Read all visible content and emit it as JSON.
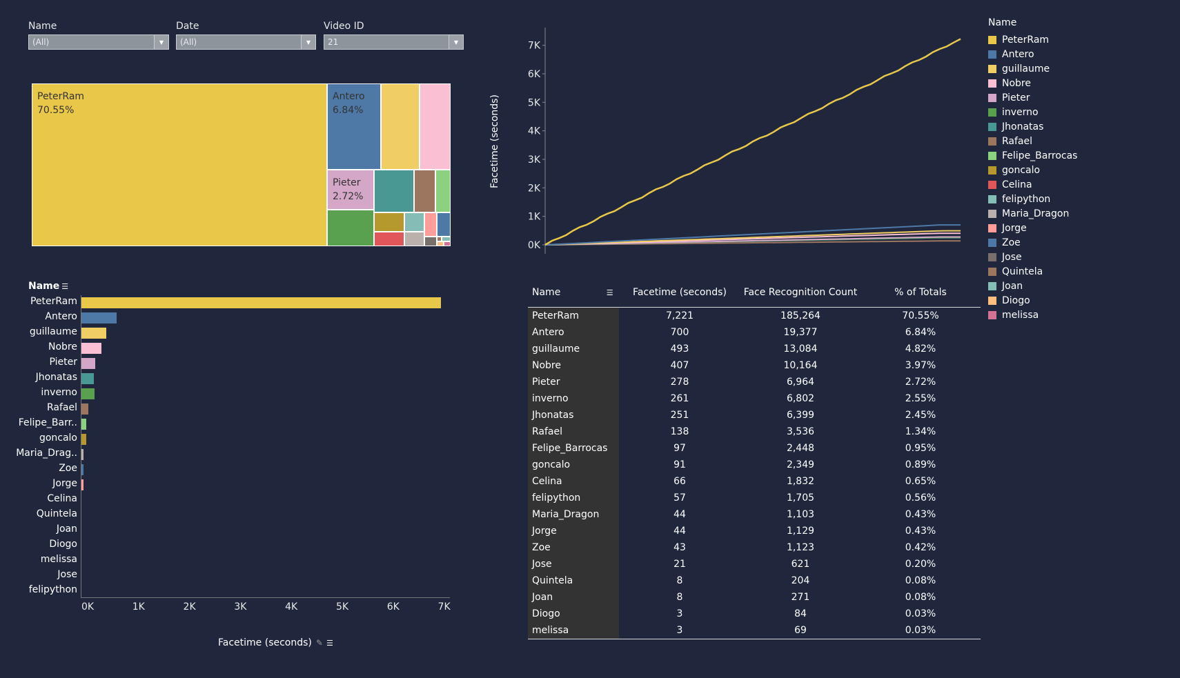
{
  "filters": [
    {
      "label": "Name",
      "value": "(All)"
    },
    {
      "label": "Date",
      "value": "(All)"
    },
    {
      "label": "Video ID",
      "value": "21"
    }
  ],
  "treemap": {
    "cells": [
      {
        "name": "PeterRam",
        "pct": "70.55%",
        "color": "#e9c748"
      },
      {
        "name": "Antero",
        "pct": "6.84%",
        "color": "#4e79a7"
      },
      {
        "name": "guillaume",
        "pct": "",
        "color": "#f1ce63"
      },
      {
        "name": "Nobre",
        "pct": "",
        "color": "#fabfd2"
      },
      {
        "name": "Pieter",
        "pct": "2.72%",
        "color": "#d4a6c8"
      },
      {
        "name": "inverno",
        "pct": "",
        "color": "#59a14f"
      },
      {
        "name": "Jhonatas",
        "pct": "",
        "color": "#499894"
      },
      {
        "name": "Rafael",
        "pct": "",
        "color": "#9d7660"
      },
      {
        "name": "Felipe_Barrocas",
        "pct": "",
        "color": "#8cd17d"
      },
      {
        "name": "goncalo",
        "pct": "",
        "color": "#b6992d"
      },
      {
        "name": "Celina",
        "pct": "",
        "color": "#e15759"
      },
      {
        "name": "felipython",
        "pct": "",
        "color": "#86bcb6"
      },
      {
        "name": "Maria_Dragon",
        "pct": "",
        "color": "#bab0ac"
      },
      {
        "name": "Jorge",
        "pct": "",
        "color": "#ff9d9a"
      },
      {
        "name": "Zoe",
        "pct": "",
        "color": "#4e79a7"
      },
      {
        "name": "Jose",
        "pct": "",
        "color": "#79706e"
      },
      {
        "name": "Quintela",
        "pct": "",
        "color": "#9d7660"
      },
      {
        "name": "Joan",
        "pct": "",
        "color": "#86bcb6"
      },
      {
        "name": "Diogo",
        "pct": "",
        "color": "#ffbe7d"
      },
      {
        "name": "melissa",
        "pct": "",
        "color": "#d37295"
      }
    ]
  },
  "bar_chart": {
    "header": "Name",
    "x_title": "Facetime (seconds)",
    "ticks": [
      "0K",
      "1K",
      "2K",
      "3K",
      "4K",
      "5K",
      "6K",
      "7K"
    ],
    "rows": [
      {
        "name": "PeterRam",
        "value": 7221,
        "color": "#e9c748"
      },
      {
        "name": "Antero",
        "value": 700,
        "color": "#4e79a7"
      },
      {
        "name": "guillaume",
        "value": 493,
        "color": "#f1ce63"
      },
      {
        "name": "Nobre",
        "value": 407,
        "color": "#fabfd2"
      },
      {
        "name": "Pieter",
        "value": 278,
        "color": "#d4a6c8"
      },
      {
        "name": "Jhonatas",
        "value": 251,
        "color": "#499894"
      },
      {
        "name": "inverno",
        "value": 261,
        "color": "#59a14f"
      },
      {
        "name": "Rafael",
        "value": 138,
        "color": "#9d7660"
      },
      {
        "name": "Felipe_Barr..",
        "value": 97,
        "color": "#8cd17d"
      },
      {
        "name": "goncalo",
        "value": 91,
        "color": "#b6992d"
      },
      {
        "name": "Maria_Drag..",
        "value": 44,
        "color": "#bab0ac"
      },
      {
        "name": "Zoe",
        "value": 43,
        "color": "#4e79a7"
      },
      {
        "name": "Jorge",
        "value": 44,
        "color": "#ff9d9a"
      },
      {
        "name": "Celina",
        "value": 0,
        "color": "#e15759"
      },
      {
        "name": "Quintela",
        "value": 0,
        "color": "#9d7660"
      },
      {
        "name": "Joan",
        "value": 0,
        "color": "#86bcb6"
      },
      {
        "name": "Diogo",
        "value": 0,
        "color": "#ffbe7d"
      },
      {
        "name": "melissa",
        "value": 0,
        "color": "#d37295"
      },
      {
        "name": "Jose",
        "value": 0,
        "color": "#79706e"
      },
      {
        "name": "felipython",
        "value": 0,
        "color": "#86bcb6"
      }
    ]
  },
  "line_chart": {
    "y_title": "Facetime (seconds)",
    "y_ticks": [
      "0K",
      "1K",
      "2K",
      "3K",
      "4K",
      "5K",
      "6K",
      "7K"
    ],
    "series": [
      {
        "name": "PeterRam",
        "final": 7221,
        "color": "#e9c748"
      },
      {
        "name": "Antero",
        "final": 700,
        "color": "#4e79a7"
      },
      {
        "name": "guillaume",
        "final": 493,
        "color": "#f1ce63"
      },
      {
        "name": "Nobre",
        "final": 407,
        "color": "#fabfd2"
      },
      {
        "name": "Pieter",
        "final": 278,
        "color": "#d4a6c8"
      },
      {
        "name": "inverno",
        "final": 261,
        "color": "#59a14f"
      },
      {
        "name": "Jhonatas",
        "final": 251,
        "color": "#499894"
      },
      {
        "name": "Rafael",
        "final": 138,
        "color": "#9d7660"
      }
    ]
  },
  "table": {
    "headers": [
      "Name",
      "Facetime (seconds)",
      "Face Recognition Count",
      "% of Totals"
    ],
    "rows": [
      [
        "PeterRam",
        "7,221",
        "185,264",
        "70.55%"
      ],
      [
        "Antero",
        "700",
        "19,377",
        "6.84%"
      ],
      [
        "guillaume",
        "493",
        "13,084",
        "4.82%"
      ],
      [
        "Nobre",
        "407",
        "10,164",
        "3.97%"
      ],
      [
        "Pieter",
        "278",
        "6,964",
        "2.72%"
      ],
      [
        "inverno",
        "261",
        "6,802",
        "2.55%"
      ],
      [
        "Jhonatas",
        "251",
        "6,399",
        "2.45%"
      ],
      [
        "Rafael",
        "138",
        "3,536",
        "1.34%"
      ],
      [
        "Felipe_Barrocas",
        "97",
        "2,448",
        "0.95%"
      ],
      [
        "goncalo",
        "91",
        "2,349",
        "0.89%"
      ],
      [
        "Celina",
        "66",
        "1,832",
        "0.65%"
      ],
      [
        "felipython",
        "57",
        "1,705",
        "0.56%"
      ],
      [
        "Maria_Dragon",
        "44",
        "1,103",
        "0.43%"
      ],
      [
        "Jorge",
        "44",
        "1,129",
        "0.43%"
      ],
      [
        "Zoe",
        "43",
        "1,123",
        "0.42%"
      ],
      [
        "Jose",
        "21",
        "621",
        "0.20%"
      ],
      [
        "Quintela",
        "8",
        "204",
        "0.08%"
      ],
      [
        "Joan",
        "8",
        "271",
        "0.08%"
      ],
      [
        "Diogo",
        "3",
        "84",
        "0.03%"
      ],
      [
        "melissa",
        "3",
        "69",
        "0.03%"
      ]
    ]
  },
  "legend": {
    "title": "Name",
    "items": [
      {
        "name": "PeterRam",
        "color": "#e9c748"
      },
      {
        "name": "Antero",
        "color": "#4e79a7"
      },
      {
        "name": "guillaume",
        "color": "#f1ce63"
      },
      {
        "name": "Nobre",
        "color": "#fabfd2"
      },
      {
        "name": "Pieter",
        "color": "#d4a6c8"
      },
      {
        "name": "inverno",
        "color": "#59a14f"
      },
      {
        "name": "Jhonatas",
        "color": "#499894"
      },
      {
        "name": "Rafael",
        "color": "#9d7660"
      },
      {
        "name": "Felipe_Barrocas",
        "color": "#8cd17d"
      },
      {
        "name": "goncalo",
        "color": "#b6992d"
      },
      {
        "name": "Celina",
        "color": "#e15759"
      },
      {
        "name": "felipython",
        "color": "#86bcb6"
      },
      {
        "name": "Maria_Dragon",
        "color": "#bab0ac"
      },
      {
        "name": "Jorge",
        "color": "#ff9d9a"
      },
      {
        "name": "Zoe",
        "color": "#4e79a7"
      },
      {
        "name": "Jose",
        "color": "#79706e"
      },
      {
        "name": "Quintela",
        "color": "#9d7660"
      },
      {
        "name": "Joan",
        "color": "#86bcb6"
      },
      {
        "name": "Diogo",
        "color": "#ffbe7d"
      },
      {
        "name": "melissa",
        "color": "#d37295"
      }
    ]
  },
  "chart_data": [
    {
      "type": "bar",
      "categories": [
        "PeterRam",
        "Antero",
        "guillaume",
        "Nobre",
        "Pieter",
        "Jhonatas",
        "inverno",
        "Rafael",
        "Felipe_Barr..",
        "goncalo",
        "Maria_Drag..",
        "Zoe",
        "Jorge",
        "Celina",
        "Quintela",
        "Joan",
        "Diogo",
        "melissa",
        "Jose",
        "felipython"
      ],
      "values": [
        7221,
        700,
        493,
        407,
        278,
        251,
        261,
        138,
        97,
        91,
        44,
        43,
        44,
        0,
        0,
        0,
        0,
        0,
        0,
        0
      ],
      "xlabel": "Facetime (seconds)",
      "xlim": [
        0,
        7400
      ]
    },
    {
      "type": "line",
      "ylabel": "Facetime (seconds)",
      "ylim": [
        0,
        7500
      ],
      "series": [
        {
          "name": "PeterRam",
          "final_value": 7221
        },
        {
          "name": "Antero",
          "final_value": 700
        },
        {
          "name": "guillaume",
          "final_value": 493
        },
        {
          "name": "Nobre",
          "final_value": 407
        },
        {
          "name": "Pieter",
          "final_value": 278
        },
        {
          "name": "inverno",
          "final_value": 261
        },
        {
          "name": "Jhonatas",
          "final_value": 251
        },
        {
          "name": "Rafael",
          "final_value": 138
        }
      ]
    }
  ]
}
